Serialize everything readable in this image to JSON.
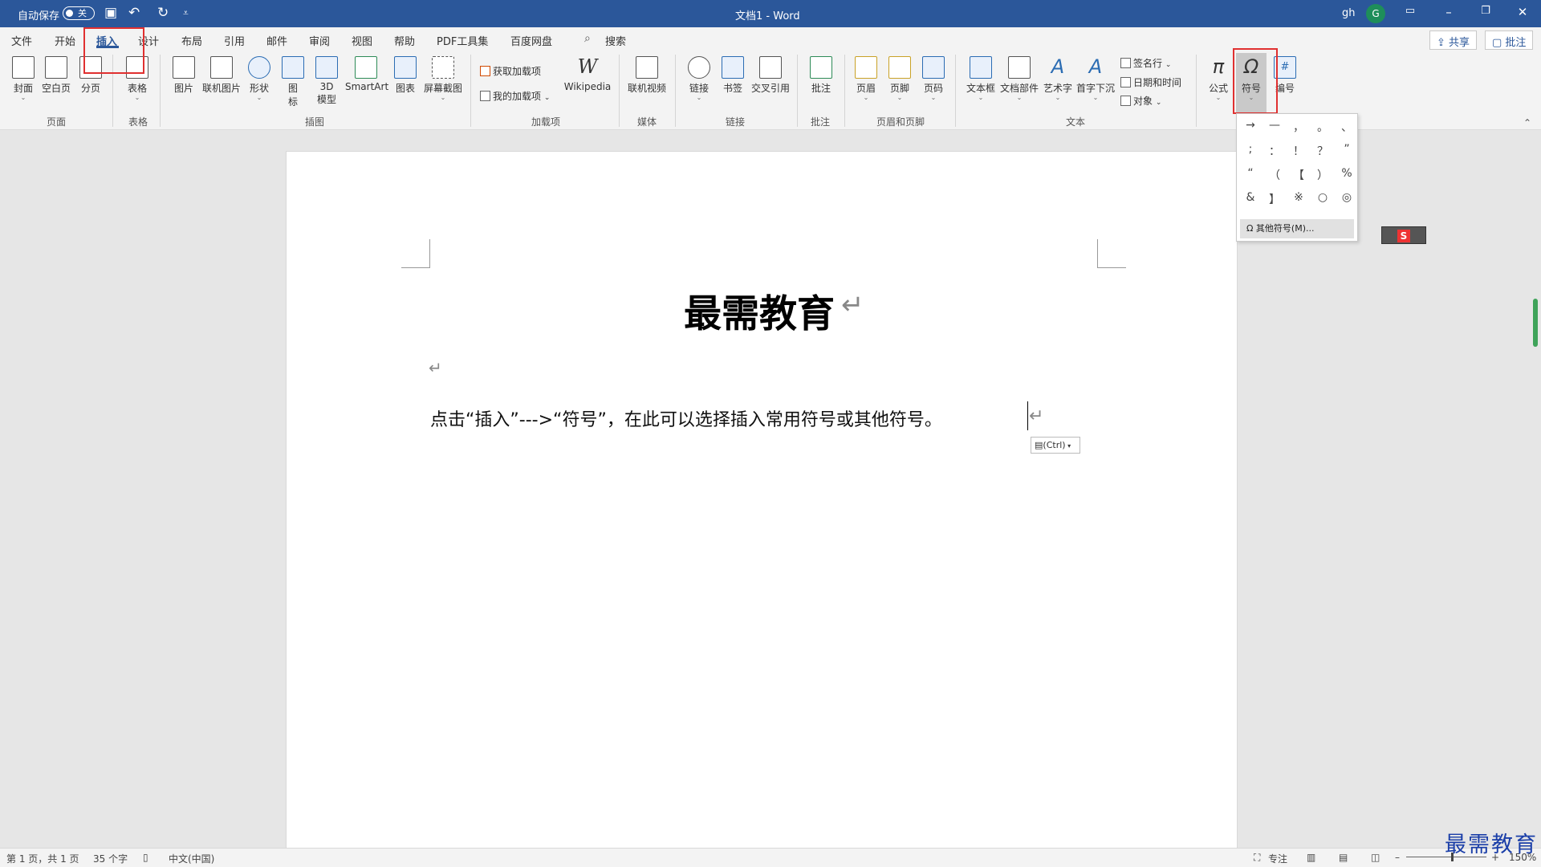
{
  "titlebar": {
    "autosave_label": "自动保存",
    "autosave_state": "关",
    "doc_title": "文档1  -  Word",
    "user": "gh",
    "avatar_letter": "G",
    "icons": [
      "save-icon",
      "undo-icon",
      "redo-icon",
      "customize-icon",
      "ribbon-display-icon",
      "minimize-icon",
      "restore-icon",
      "close-icon"
    ]
  },
  "tabs": [
    "文件",
    "开始",
    "插入",
    "设计",
    "布局",
    "引用",
    "邮件",
    "审阅",
    "视图",
    "帮助",
    "PDF工具集",
    "百度网盘"
  ],
  "active_tab": "插入",
  "search_label": "搜索",
  "share_label": "共享",
  "comments_label": "批注",
  "ribbon": {
    "pages_group": {
      "label": "页面",
      "cover": "封面",
      "blank": "空白页",
      "break": "分页"
    },
    "tables_group": {
      "label": "表格",
      "table": "表格"
    },
    "illustrations_group": {
      "label": "插图",
      "picture": "图片",
      "online_picture": "联机图片",
      "shapes": "形状",
      "icons": "图\n标",
      "model3d": "3D\n模型",
      "smartart": "SmartArt",
      "chart": "图表",
      "screenshot": "屏幕截图"
    },
    "addins_group": {
      "label": "加载项",
      "get_addins": "获取加载项",
      "my_addins": "我的加载项",
      "wikipedia": "Wikipedia"
    },
    "media_group": {
      "label": "媒体",
      "online_video": "联机视频"
    },
    "links_group": {
      "label": "链接",
      "link": "链接",
      "bookmark": "书签",
      "crossref": "交叉引用"
    },
    "comments_group": {
      "label": "批注",
      "comment": "批注"
    },
    "header_footer_group": {
      "label": "页眉和页脚",
      "header": "页眉",
      "footer": "页脚",
      "page_number": "页码"
    },
    "text_group": {
      "label": "文本",
      "textbox": "文本框",
      "quickparts": "文档部件",
      "wordart": "艺术字",
      "dropcap": "首字下沉",
      "signature": "签名行",
      "datetime": "日期和时间",
      "object": "对象"
    },
    "symbols_group": {
      "equation": "公式",
      "symbol": "符号",
      "number": "编号"
    }
  },
  "symbol_dropdown": {
    "symbols": [
      "→",
      "—",
      "，",
      "。",
      "、",
      ";",
      "：",
      "！",
      "？",
      "”",
      "“",
      "（",
      "【",
      "）",
      "%",
      "&",
      "】",
      "※",
      "○",
      "◎"
    ],
    "more_label": "其他符号(M)..."
  },
  "document": {
    "title": "最需教育",
    "body": "点击“插入”--->“符号”，在此可以选择插入常用符号或其他符号。",
    "paste_options": "(Ctrl)"
  },
  "statusbar": {
    "page": "第 1 页，共 1 页",
    "words": "35 个字",
    "language": "中文(中国)",
    "focus": "专注",
    "zoom": "150%"
  },
  "watermark": "最需教育",
  "colors": {
    "title_bar": "#2b579a",
    "highlight_box": "#e03030",
    "watermark": "#1a3ea8"
  }
}
